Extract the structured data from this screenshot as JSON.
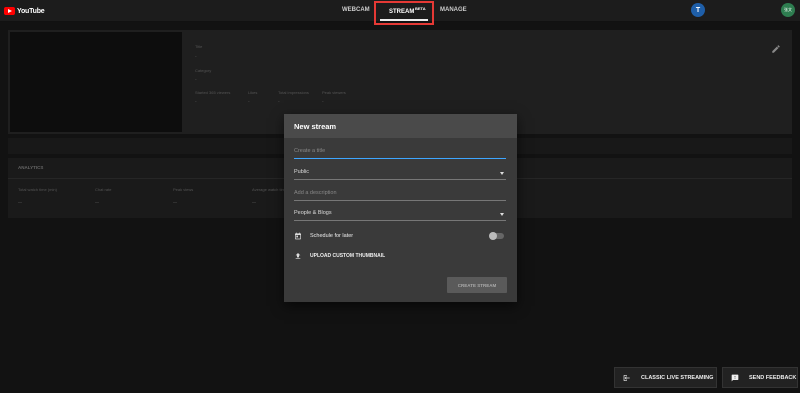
{
  "app": {
    "logo_text": "YouTube"
  },
  "nav": {
    "tabs": [
      {
        "label": "WEBCAM"
      },
      {
        "label": "STREAM",
        "badge": "BETA"
      },
      {
        "label": "MANAGE"
      }
    ],
    "avatar_initial": "T",
    "user_avatar_text": "张文"
  },
  "stream_panel": {
    "title_label": "Title",
    "title_value": "-",
    "category_label": "Category",
    "category_value": "-",
    "stats": [
      {
        "label": "Started 365 viewers",
        "value": "-"
      },
      {
        "label": "Likes",
        "value": "-"
      },
      {
        "label": "Total impressions",
        "value": "-"
      },
      {
        "label": "Peak viewers",
        "value": "-"
      }
    ]
  },
  "analytics": {
    "title": "ANALYTICS",
    "stats": [
      {
        "label": "Total watch time (min)",
        "value": "--"
      },
      {
        "label": "Chat rate",
        "value": "--"
      },
      {
        "label": "Peak views",
        "value": "--"
      },
      {
        "label": "Average watch time",
        "value": "--"
      }
    ]
  },
  "modal": {
    "title": "New stream",
    "title_placeholder": "Create a title",
    "privacy_value": "Public",
    "description_placeholder": "Add a description",
    "category_value": "People & Blogs",
    "schedule_label": "Schedule for later",
    "upload_label": "UPLOAD CUSTOM THUMBNAIL",
    "create_button": "CREATE STREAM"
  },
  "bottom": {
    "classic_label": "CLASSIC LIVE STREAMING",
    "feedback_label": "SEND FEEDBACK"
  }
}
